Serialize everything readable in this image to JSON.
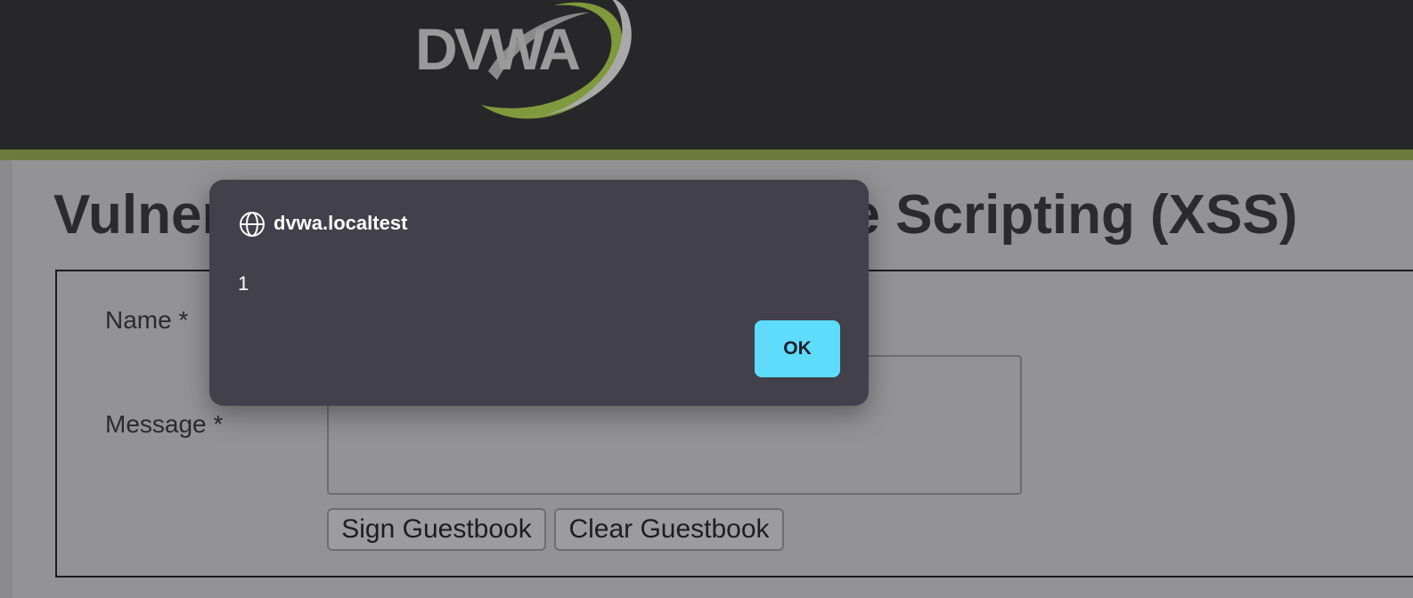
{
  "header": {
    "logo_text": "DVWA"
  },
  "page": {
    "title": "Vulnerability: Stored Cross Site Scripting (XSS)"
  },
  "form": {
    "name_label": "Name *",
    "name_value": "",
    "message_label": "Message *",
    "message_value": "",
    "sign_button": "Sign Guestbook",
    "clear_button": "Clear Guestbook"
  },
  "alert_dialog": {
    "origin_icon": "globe-icon",
    "origin": "dvwa.localtest",
    "message": "1",
    "ok_label": "OK"
  },
  "colors": {
    "header_bg": "#27272a",
    "accent_green": "#6d7b3d",
    "dialog_bg": "#42404b",
    "ok_button": "#5fdcfb"
  }
}
